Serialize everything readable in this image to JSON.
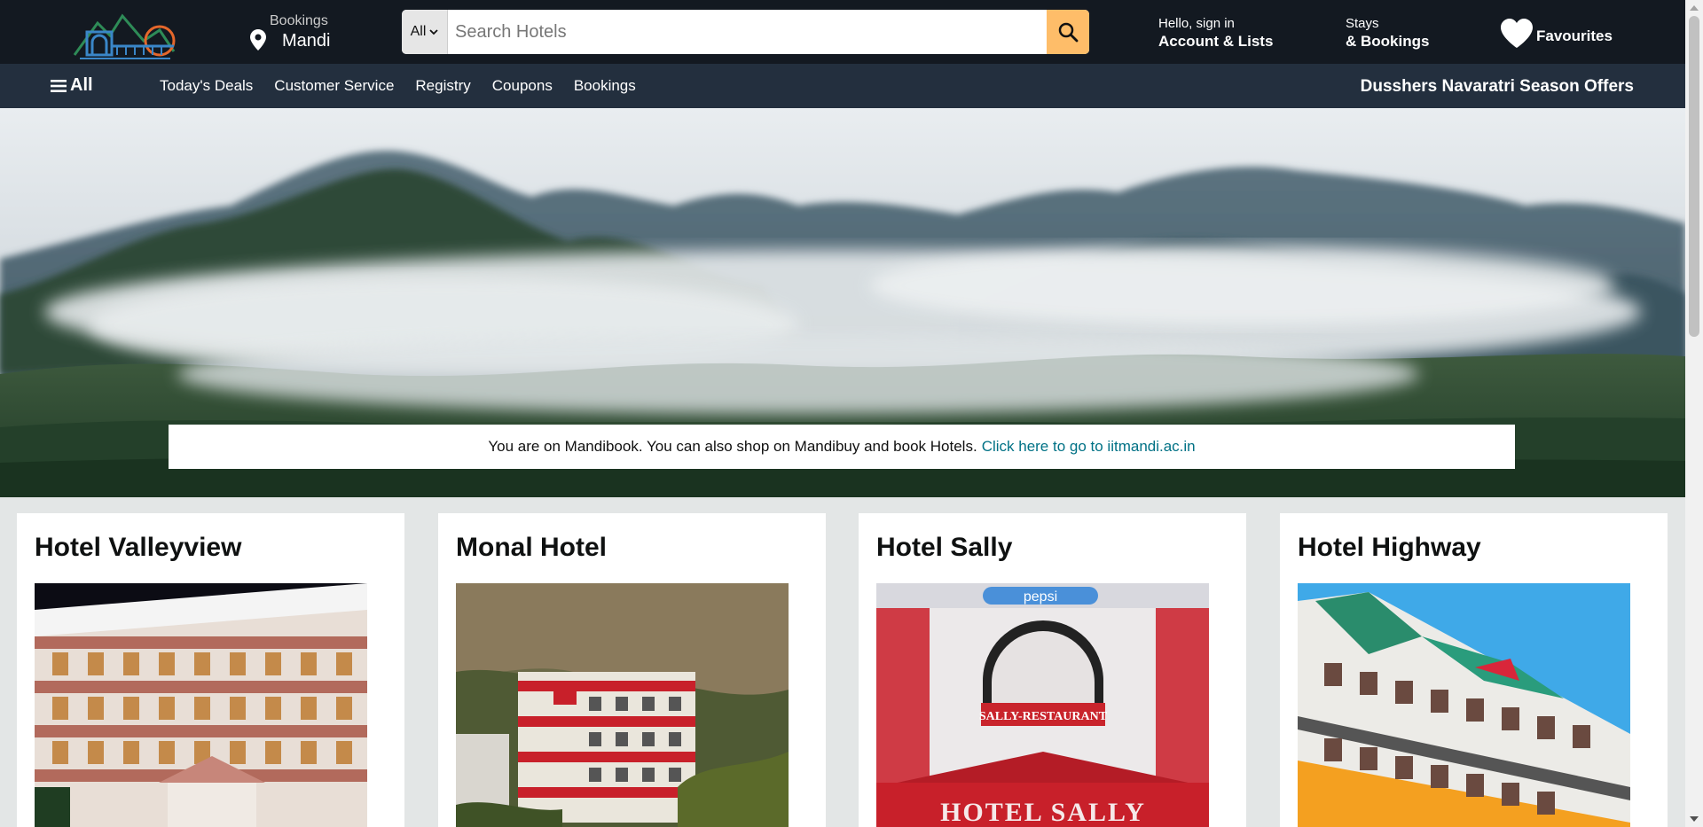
{
  "header": {
    "logo_icon": "mandi-logo",
    "location_label": "Bookings",
    "location_value": "Mandi",
    "search_category": "All",
    "search_placeholder": "Search Hotels",
    "account_greeting": "Hello, sign in",
    "account_label": "Account & Lists",
    "stays_label": "Stays",
    "bookings_label": "& Bookings",
    "favourites_label": "Favourites"
  },
  "nav": {
    "all_label": "All",
    "links": [
      "Today's Deals",
      "Customer Service",
      "Registry",
      "Coupons",
      "Bookings"
    ],
    "offer": "Dusshers Navaratri Season Offers"
  },
  "hero": {
    "notice_text": "You are on Mandibook. You can also shop on Mandibuy and book Hotels.",
    "notice_link": "Click here to go to iitmandi.ac.in"
  },
  "hotels": [
    {
      "name": "Hotel Valleyview"
    },
    {
      "name": "Monal Hotel"
    },
    {
      "name": "Hotel Sally",
      "sign_text": "HOTEL SALLY",
      "restaurant_text": "SALLY-RESTAURANT",
      "brand_text": "pepsi"
    },
    {
      "name": "Hotel Highway"
    }
  ],
  "colors": {
    "header_bg": "#131921",
    "nav_bg": "#232f3e",
    "search_button": "#febd69",
    "link": "#007185",
    "page_bg": "#e3e6e6"
  }
}
